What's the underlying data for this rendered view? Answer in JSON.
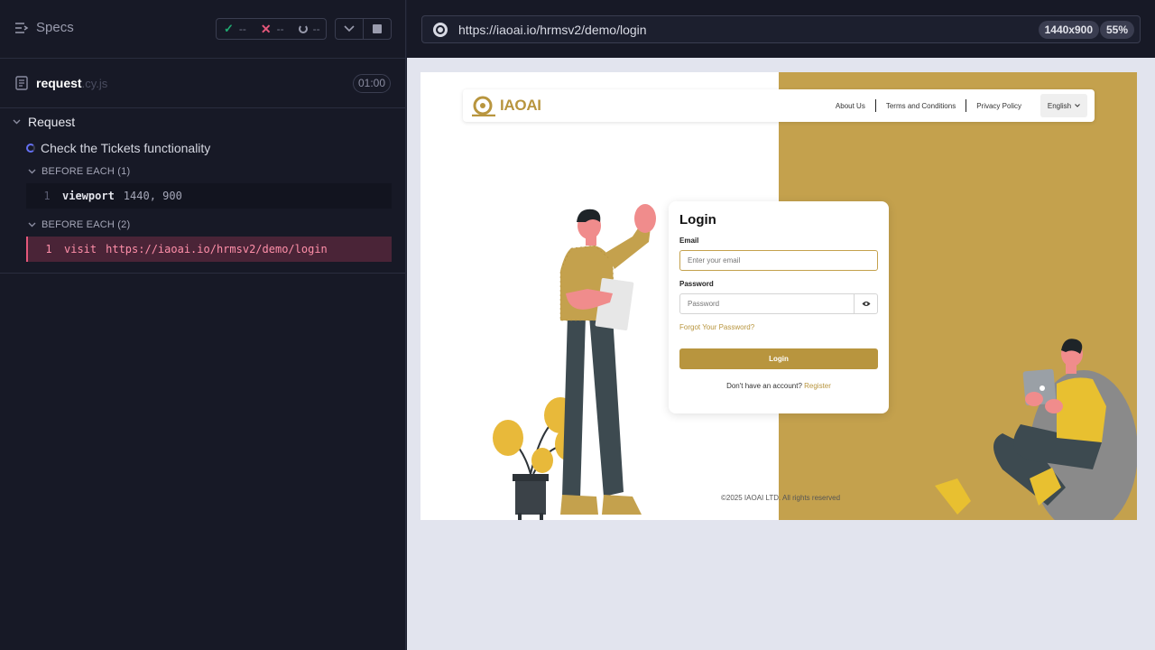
{
  "reporter": {
    "specs_label": "Specs",
    "stats": {
      "passed": "--",
      "failed": "--",
      "pending": "--"
    },
    "spec": {
      "name": "request",
      "ext": ".cy.js",
      "duration": "01:00"
    },
    "suite": {
      "title": "Request",
      "test": "Check the Tickets functionality",
      "hooks": [
        {
          "label": "BEFORE EACH (1)",
          "commands": [
            {
              "num": "1",
              "name": "viewport",
              "arg": "1440, 900"
            }
          ]
        },
        {
          "label": "BEFORE EACH (2)",
          "commands": [
            {
              "num": "1",
              "name": "visit",
              "arg": "https://iaoai.io/hrmsv2/demo/login"
            }
          ]
        }
      ]
    }
  },
  "runner": {
    "url": "https://iaoai.io/hrmsv2/demo/login",
    "viewport": "1440x900",
    "zoom": "55%"
  },
  "site": {
    "logo_text": "IAOAI",
    "nav": {
      "about": "About Us",
      "terms": "Terms and Conditions",
      "privacy": "Privacy Policy",
      "language": "English"
    },
    "login": {
      "title": "Login",
      "email_label": "Email",
      "email_placeholder": "Enter your email",
      "password_label": "Password",
      "password_placeholder": "Password",
      "forgot": "Forgot Your Password?",
      "button": "Login",
      "no_account": "Don't have an account?",
      "register": "Register"
    },
    "footer": "©2025 IAOAI LTD. All rights reserved"
  },
  "colors": {
    "accent": "#c4a14d",
    "fail": "#e4577a",
    "pass": "#1fa971"
  }
}
